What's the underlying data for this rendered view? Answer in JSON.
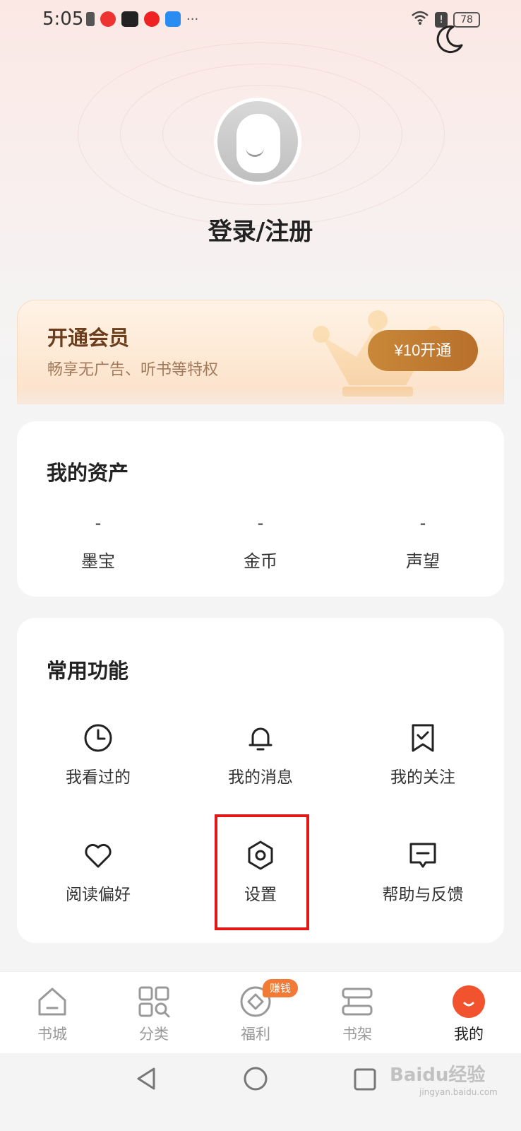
{
  "status_bar": {
    "time": "5:05",
    "battery": "78"
  },
  "profile": {
    "login_label": "登录/注册"
  },
  "vip": {
    "title": "开通会员",
    "subtitle": "畅享无广告、听书等特权",
    "button_label": "¥10开通"
  },
  "assets": {
    "title": "我的资产",
    "items": [
      {
        "value": "-",
        "label": "墨宝"
      },
      {
        "value": "-",
        "label": "金币"
      },
      {
        "value": "-",
        "label": "声望"
      }
    ]
  },
  "functions": {
    "title": "常用功能",
    "items": [
      {
        "label": "我看过的",
        "icon": "clock-icon"
      },
      {
        "label": "我的消息",
        "icon": "bell-icon"
      },
      {
        "label": "我的关注",
        "icon": "bookmark-icon"
      },
      {
        "label": "阅读偏好",
        "icon": "heart-icon"
      },
      {
        "label": "设置",
        "icon": "hexagon-settings-icon"
      },
      {
        "label": "帮助与反馈",
        "icon": "message-icon"
      }
    ]
  },
  "bottom_nav": {
    "items": [
      {
        "label": "书城",
        "icon": "home-icon"
      },
      {
        "label": "分类",
        "icon": "category-icon"
      },
      {
        "label": "福利",
        "icon": "welfare-icon",
        "badge": "赚钱"
      },
      {
        "label": "书架",
        "icon": "bookshelf-icon"
      },
      {
        "label": "我的",
        "icon": "profile-icon",
        "active": true
      }
    ]
  },
  "watermark": {
    "main": "Baidu经验",
    "sub": "jingyan.baidu.com"
  },
  "colors": {
    "accent": "#f0532d",
    "vip_button": "#c98839",
    "highlight": "#e01818"
  }
}
